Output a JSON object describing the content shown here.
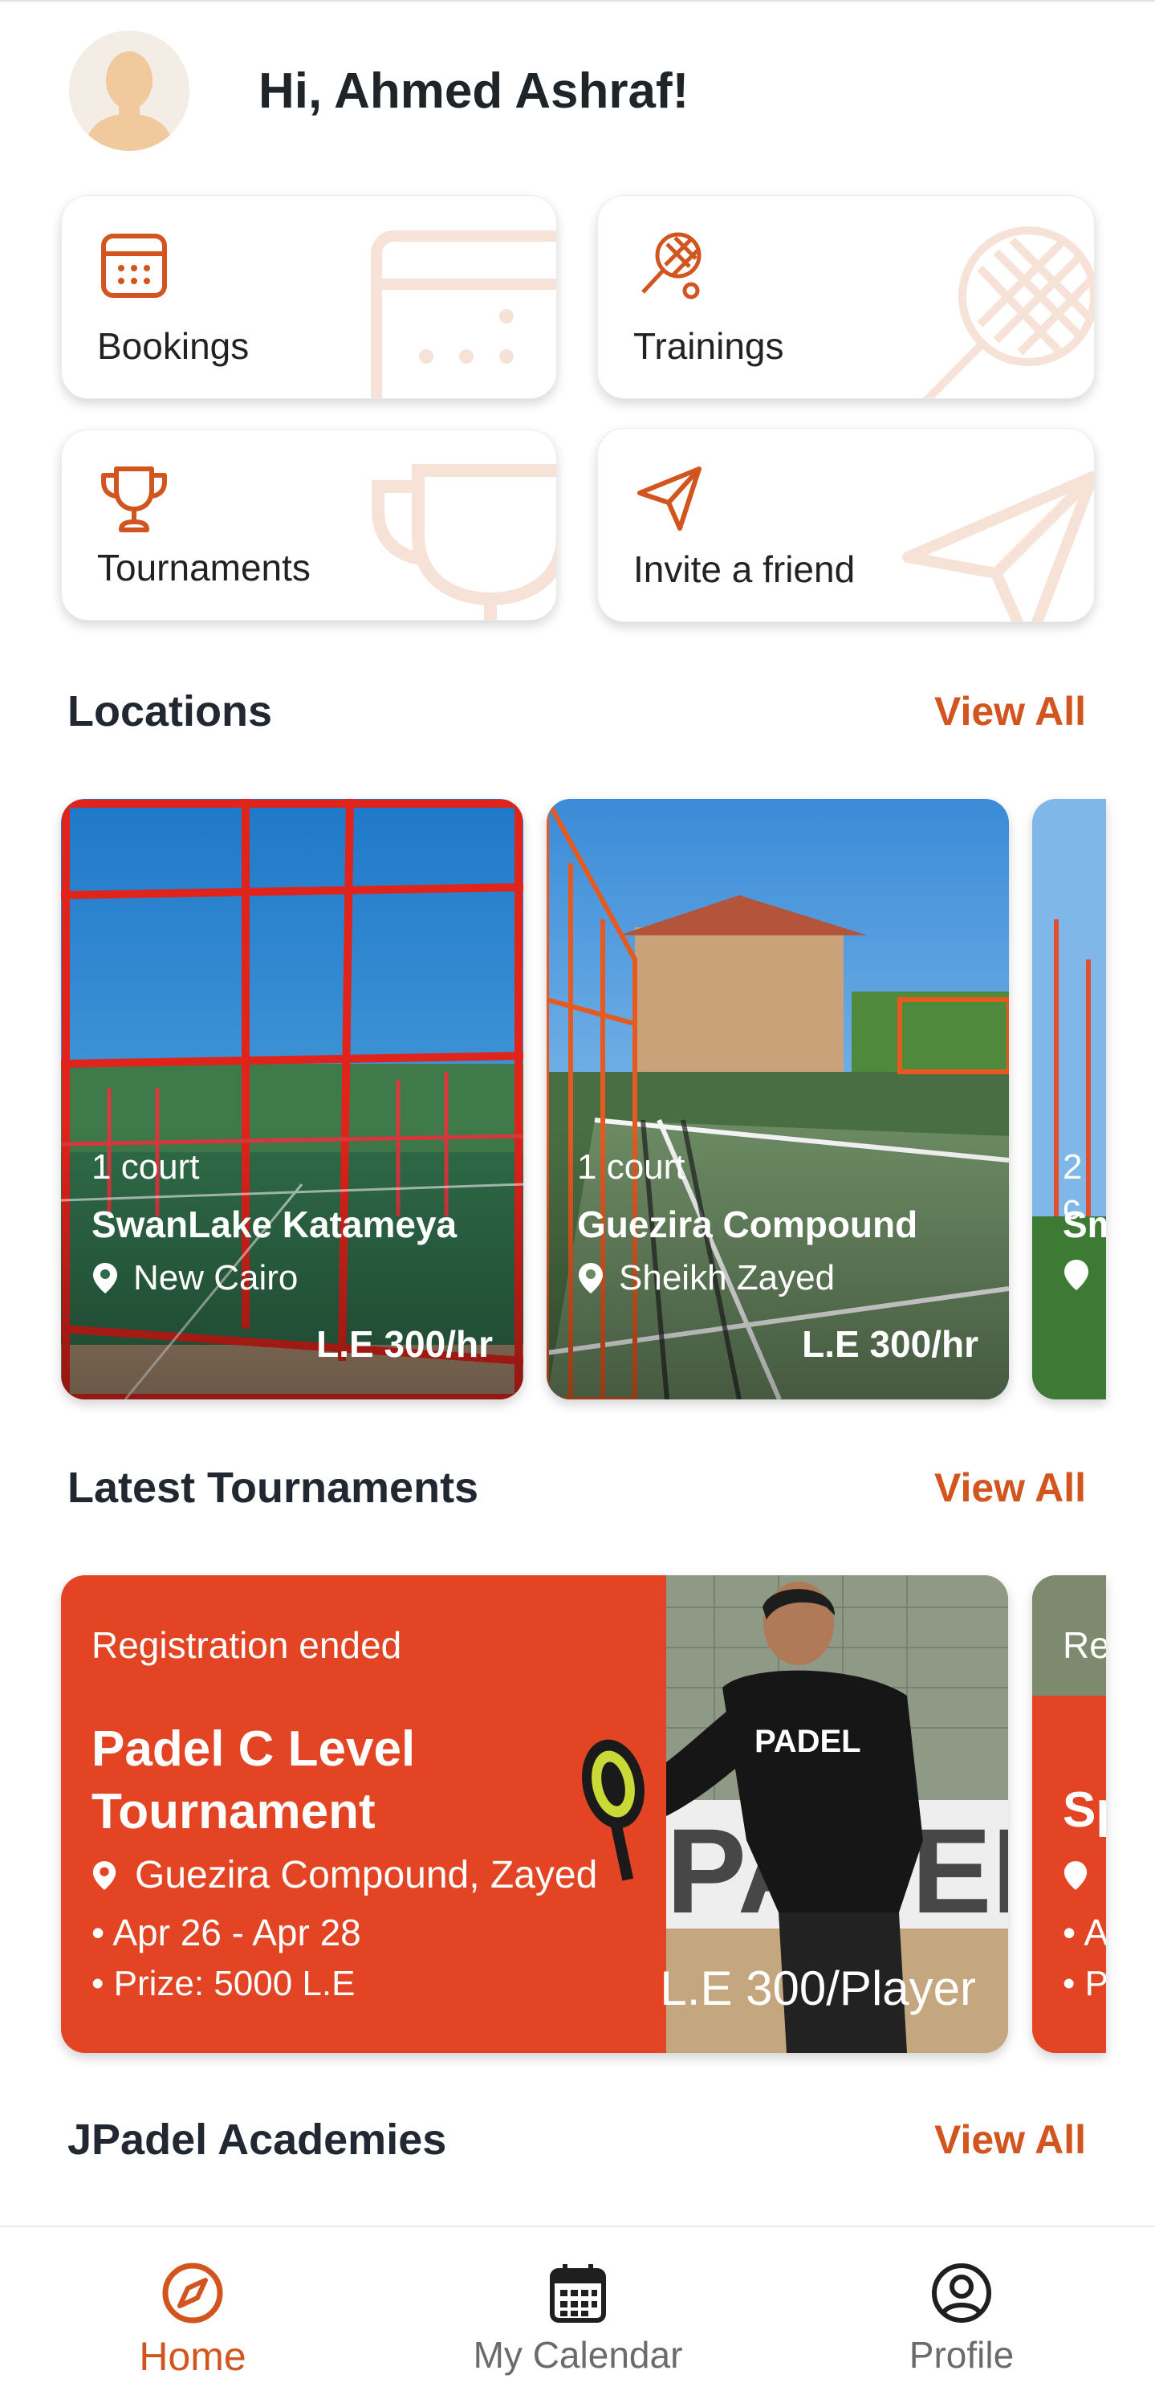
{
  "header": {
    "greeting": "Hi, Ahmed Ashraf!"
  },
  "quick_actions": [
    {
      "label": "Bookings",
      "icon": "calendar-icon"
    },
    {
      "label": "Trainings",
      "icon": "racket-icon"
    },
    {
      "label": "Tournaments",
      "icon": "trophy-icon"
    },
    {
      "label": "Invite a friend",
      "icon": "paper-plane-icon"
    }
  ],
  "locations": {
    "title": "Locations",
    "view_all": "View All",
    "items": [
      {
        "courts": "1 court",
        "name": "SwanLake Katameya",
        "area": "New Cairo",
        "price": "L.E 300/hr"
      },
      {
        "courts": "1 court",
        "name": "Guezira Compound",
        "area": "Sheikh Zayed",
        "price": "L.E 300/hr"
      },
      {
        "courts": "2 c",
        "name": "Sm",
        "area": "",
        "price": ""
      }
    ]
  },
  "tournaments": {
    "title": "Latest Tournaments",
    "view_all": "View All",
    "items": [
      {
        "status": "Registration ended",
        "name": "Padel C Level Tournament",
        "location": "Guezira Compound,  Zayed",
        "dates": "• Apr 26 - Apr 28",
        "prize": "• Prize: 5000 L.E",
        "price": "L.E 300/Player"
      },
      {
        "status": "Re",
        "name": "Sp",
        "location": "(",
        "dates": "• A",
        "prize": "• P",
        "price": ""
      }
    ]
  },
  "academies": {
    "title": "JPadel Academies",
    "view_all": "View All"
  },
  "bottom_nav": {
    "items": [
      {
        "label": "Home",
        "icon": "compass-icon",
        "active": true
      },
      {
        "label": "My Calendar",
        "icon": "calendar-icon",
        "active": false
      },
      {
        "label": "Profile",
        "icon": "user-circle-icon",
        "active": false
      }
    ]
  },
  "colors": {
    "accent": "#d2541e",
    "tournament_card": "#e34524",
    "text_dark": "#222831"
  }
}
